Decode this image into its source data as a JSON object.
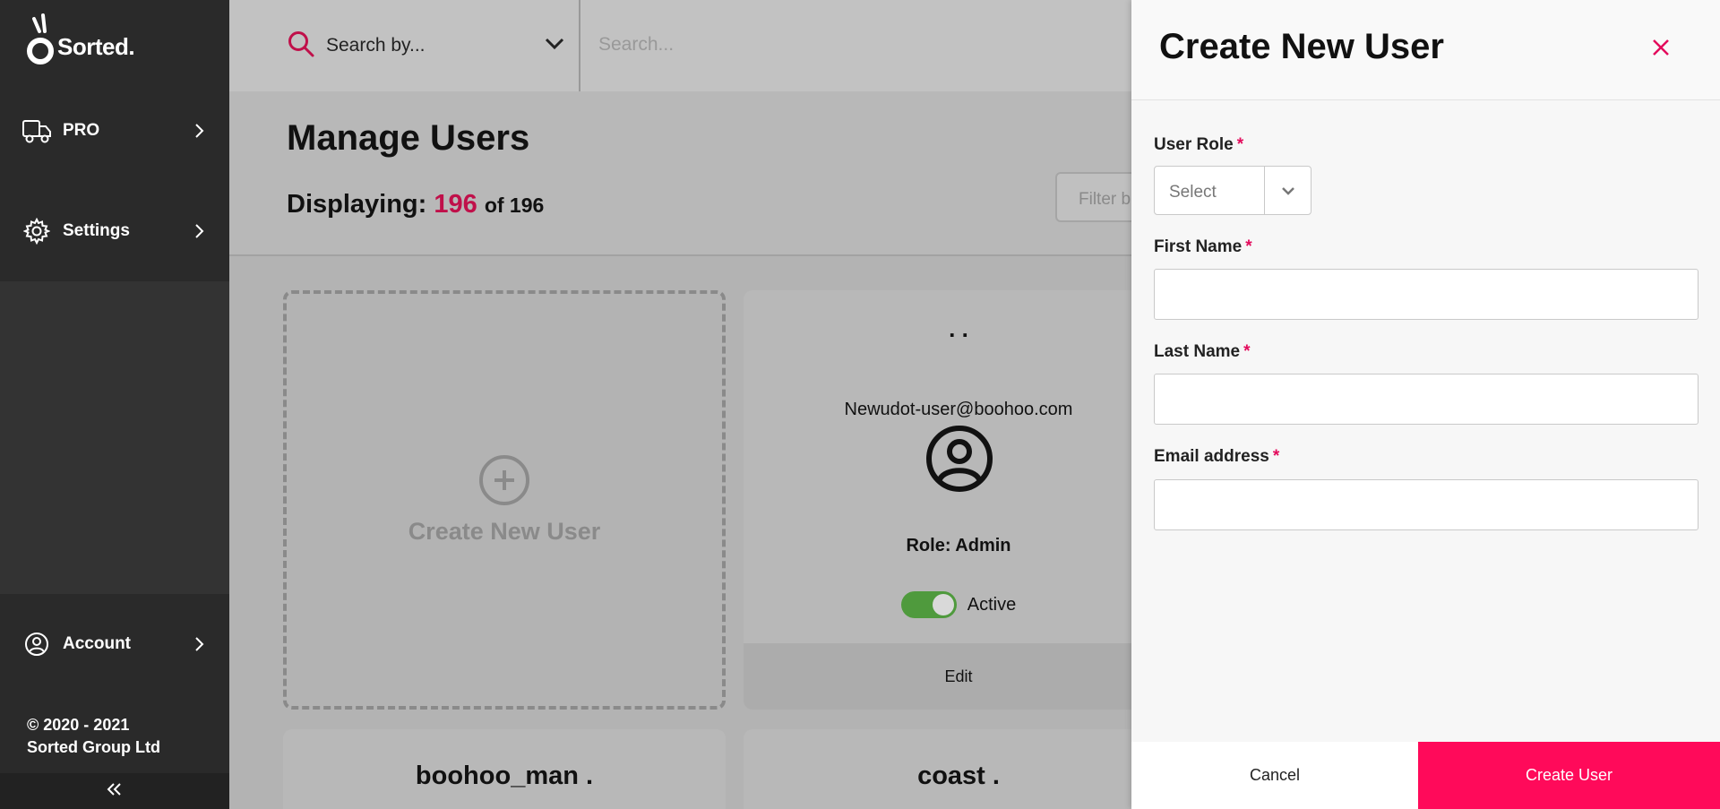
{
  "brand": {
    "name": "Sorted."
  },
  "sidebar": {
    "items": [
      {
        "label": "PRO",
        "icon": "truck-icon"
      },
      {
        "label": "Settings",
        "icon": "gear-icon"
      }
    ],
    "account": {
      "label": "Account",
      "icon": "user-circle-icon"
    },
    "copyright_line1": "© 2020 - 2021",
    "copyright_line2": "Sorted Group Ltd"
  },
  "search": {
    "by_label": "Search by...",
    "placeholder": "Search..."
  },
  "page": {
    "title": "Manage Users",
    "displaying_label": "Displaying:",
    "displaying_count": "196",
    "displaying_total": "of 196",
    "filter_placeholder": "Filter b"
  },
  "cards": {
    "create_label": "Create New User",
    "user": {
      "name": ". .",
      "email": "Newudot-user@boohoo.com",
      "role": "Role: Admin",
      "status": "Active",
      "active": true,
      "edit_label": "Edit"
    },
    "next_row": [
      "boohoo_man .",
      "coast ."
    ]
  },
  "panel": {
    "title": "Create New User",
    "fields": {
      "role_label": "User Role",
      "role_value": "Select",
      "first_name_label": "First Name",
      "last_name_label": "Last Name",
      "email_label": "Email address",
      "required_mark": "*"
    },
    "cancel_label": "Cancel",
    "submit_label": "Create User"
  },
  "colors": {
    "accent": "#ff0a5a",
    "count": "#c0104a",
    "toggle_on": "#4f9a3d",
    "sidebar": "#333333"
  }
}
